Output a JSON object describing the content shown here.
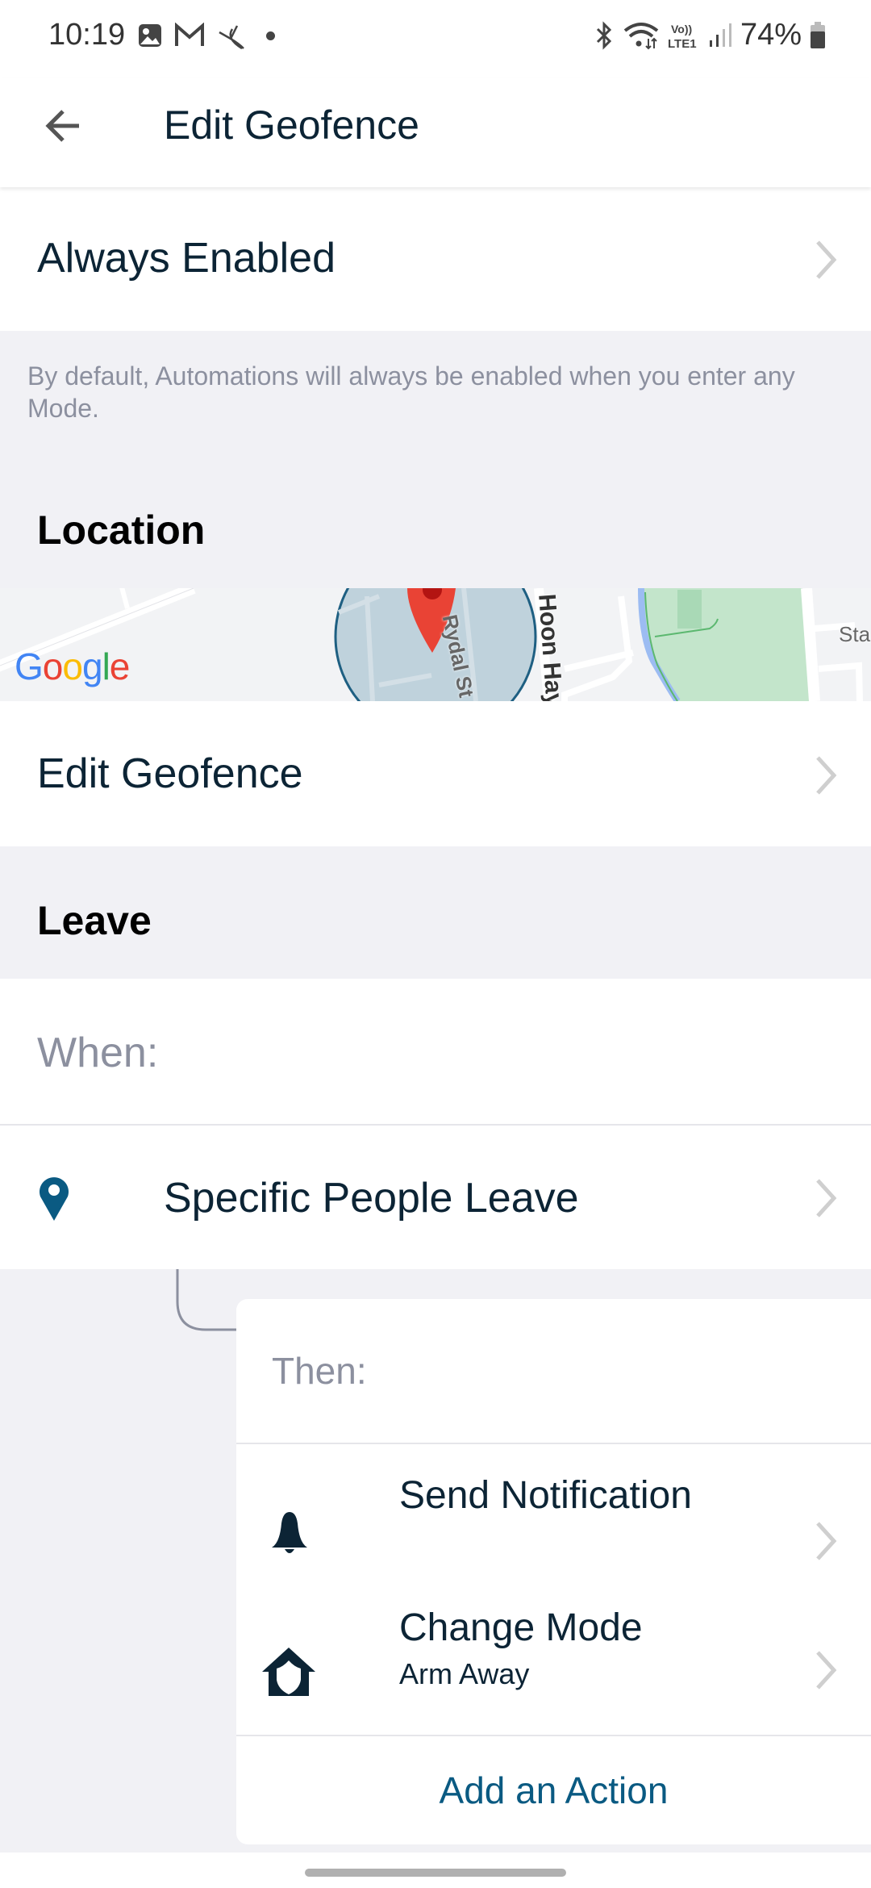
{
  "status_bar": {
    "time": "10:19",
    "left_icons": [
      "gallery-icon",
      "gmail-icon",
      "app-notification-icon",
      "dot-icon"
    ],
    "right_icons": [
      "bluetooth-icon",
      "wifi-icon",
      "volte-lte-icon",
      "signal-icon"
    ],
    "battery": "74%"
  },
  "header": {
    "back_icon": "arrow-left-icon",
    "title": "Edit Geofence"
  },
  "always_enabled": {
    "label": "Always Enabled",
    "note": "By default, Automations will always be enabled when you enter any Mode."
  },
  "location": {
    "heading": "Location",
    "map": {
      "logo": "Google",
      "streets": [
        "Rydal St",
        "Hoon Hay",
        "Sta"
      ]
    },
    "edit_label": "Edit Geofence"
  },
  "leave": {
    "heading": "Leave",
    "when_label": "When:",
    "trigger": {
      "icon": "map-pin-icon",
      "label": "Specific People Leave"
    },
    "then_label": "Then:",
    "actions": [
      {
        "icon": "bell-icon",
        "title": "Send Notification",
        "subtitle": ""
      },
      {
        "icon": "home-shield-icon",
        "title": "Change Mode",
        "subtitle": "Arm Away"
      }
    ],
    "add_action": "Add an Action"
  },
  "colors": {
    "primary_text": "#0c2435",
    "accent": "#0a5a82",
    "muted": "#8c909f",
    "background": "#f1f1f5"
  }
}
